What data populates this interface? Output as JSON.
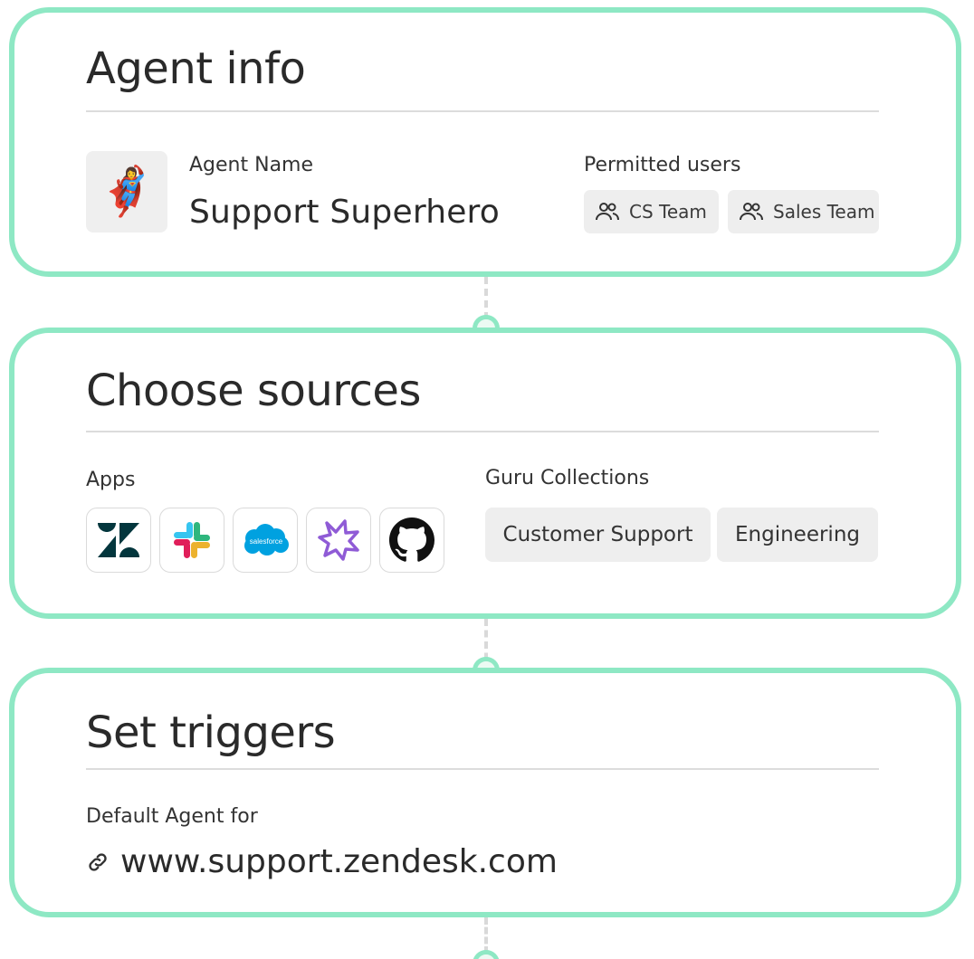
{
  "agent_info": {
    "title": "Agent info",
    "avatar_emoji": "🦸‍♀️",
    "name_label": "Agent Name",
    "name_value": "Support Superhero",
    "permitted_label": "Permitted users",
    "users": [
      "CS Team",
      "Sales Team"
    ]
  },
  "sources": {
    "title": "Choose sources",
    "apps_label": "Apps",
    "apps": [
      "zendesk-icon",
      "slack-icon",
      "salesforce-icon",
      "gong-icon",
      "github-icon"
    ],
    "salesforce_text": "salesforce",
    "collections_label": "Guru Collections",
    "collections": [
      "Customer Support",
      "Engineering"
    ]
  },
  "triggers": {
    "title": "Set triggers",
    "default_label": "Default Agent for",
    "url": "www.support.zendesk.com"
  },
  "colors": {
    "accent_border": "#8ee8c4",
    "chip_bg": "#eeeeee",
    "divider": "#dcdcdc"
  }
}
